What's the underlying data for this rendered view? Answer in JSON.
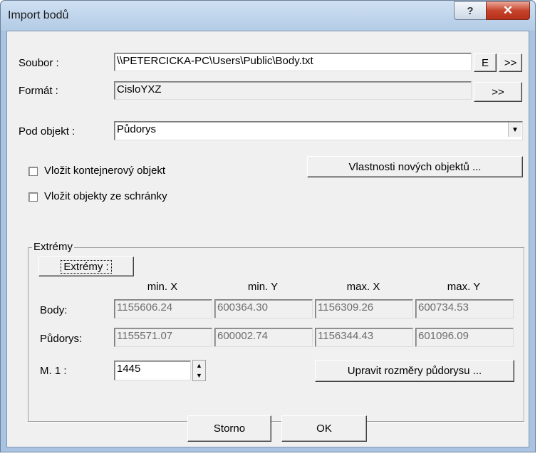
{
  "window": {
    "title": "Import bodů",
    "help_label": "?",
    "close_label": "✕"
  },
  "soubor": {
    "label": "Soubor :",
    "value": "\\\\PETERCICKA-PC\\Users\\Public\\Body.txt",
    "e_button": "E",
    "browse_button": ">>"
  },
  "format": {
    "label": "Formát :",
    "value": "CisloYXZ",
    "browse_button": ">>"
  },
  "pod_objekt": {
    "label": "Pod objekt :",
    "value": "Půdorys"
  },
  "checkboxes": {
    "kontejner": "Vložit kontejnerový objekt",
    "schranka": "Vložit objekty ze schránky"
  },
  "vlastnosti_button": "Vlastnosti nových objektů ...",
  "extremy": {
    "group_title": "Extrémy",
    "button": "Extrémy :",
    "columns": [
      "min. X",
      "min. Y",
      "max. X",
      "max. Y"
    ],
    "rows": [
      {
        "label": "Body:",
        "values": [
          "1155606.24",
          "600364.30",
          "1156309.26",
          "600734.53"
        ]
      },
      {
        "label": "Půdorys:",
        "values": [
          "1155571.07",
          "600002.74",
          "1156344.43",
          "601096.09"
        ]
      }
    ],
    "scale_label": "M. 1 :",
    "scale_value": "1445",
    "upravit_button": "Upravit rozměry půdorysu ..."
  },
  "buttons": {
    "storno": "Storno",
    "ok": "OK"
  }
}
